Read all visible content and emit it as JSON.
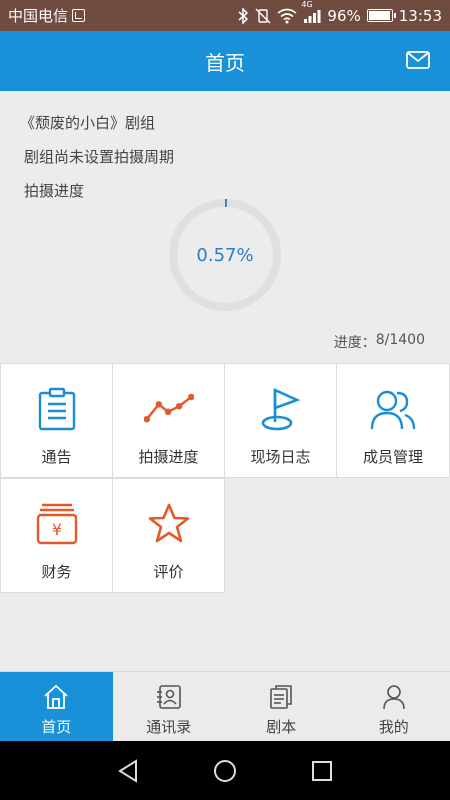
{
  "status_bar": {
    "carrier": "中国电信",
    "battery": "96%",
    "time": "13:53",
    "network": "4G",
    "battery_level": 0.96
  },
  "header": {
    "title": "首页"
  },
  "crew": {
    "name_line": "《颓废的小白》剧组",
    "schedule_line": "剧组尚未设置拍摄周期",
    "progress_label": "拍摄进度",
    "progress_percent_text": "0.57%",
    "progress_fraction": 0.0057,
    "progress_caption": "进度：",
    "progress_value": "8/1400"
  },
  "grid": [
    {
      "label": "通告",
      "icon": "clipboard-icon",
      "color": "#1a8fd6"
    },
    {
      "label": "拍摄进度",
      "icon": "trend-line-icon",
      "color": "#e25a2b"
    },
    {
      "label": "现场日志",
      "icon": "flag-icon",
      "color": "#1a8fd6"
    },
    {
      "label": "成员管理",
      "icon": "members-icon",
      "color": "#1a8fd6"
    },
    {
      "label": "财务",
      "icon": "wallet-yen-icon",
      "color": "#e25a2b"
    },
    {
      "label": "评价",
      "icon": "star-icon",
      "color": "#e25a2b"
    }
  ],
  "tabs": [
    {
      "label": "首页",
      "icon": "home-icon",
      "active": true
    },
    {
      "label": "通讯录",
      "icon": "contacts-icon",
      "active": false
    },
    {
      "label": "剧本",
      "icon": "script-icon",
      "active": false
    },
    {
      "label": "我的",
      "icon": "profile-icon",
      "active": false
    }
  ],
  "colors": {
    "brand": "#1891d9",
    "accent": "#e25a2b",
    "status_bar": "#704b3f"
  }
}
